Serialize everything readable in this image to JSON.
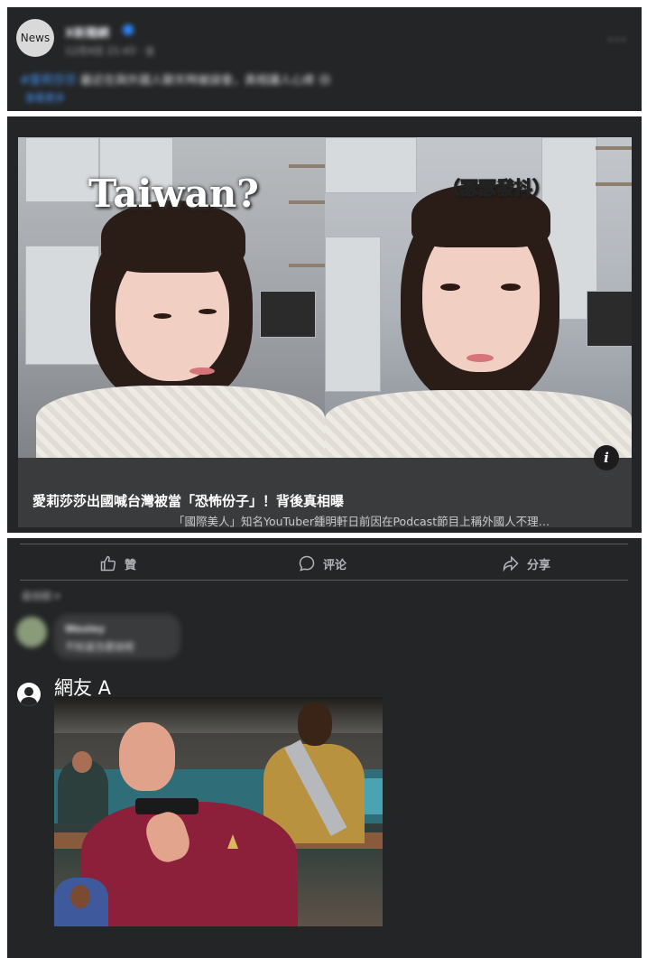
{
  "post": {
    "avatar_text": "News",
    "page_name": "X新聞網",
    "meta": "12月4日 21:43 · 全",
    "more_label": "···",
    "text_link": "#愛莉莎莎",
    "text_body": "最近在與外國人聊天時被誤會，真相讓人心疼 😢",
    "see_more": "查看更多"
  },
  "link_card": {
    "overlay_left": "Taiwan?",
    "overlay_right": "（瑟瑟發抖）",
    "info_icon": "i",
    "title": "愛莉莎莎出國喊台灣被當「恐怖份子」！背後真相曝",
    "description": "「國際美人」知名YouTuber鍾明軒日前因在Podcast節目上稱外國人不理…"
  },
  "actions": {
    "like": "贊",
    "comment": "评论",
    "share": "分享"
  },
  "comments": {
    "sort_label": "最相關 ▾",
    "first": {
      "name": "Wesley",
      "text": "不知道怎麼說呢"
    },
    "reply": {
      "name": "網友 A"
    }
  },
  "colors": {
    "card_bg": "#242526",
    "accent_link": "#4599ff",
    "muted_text": "#b0b3b8"
  },
  "icons": {
    "like": "thumbs-up-icon",
    "comment": "speech-bubble-icon",
    "share": "share-arrow-icon",
    "user": "user-avatar-icon",
    "info": "info-icon"
  }
}
